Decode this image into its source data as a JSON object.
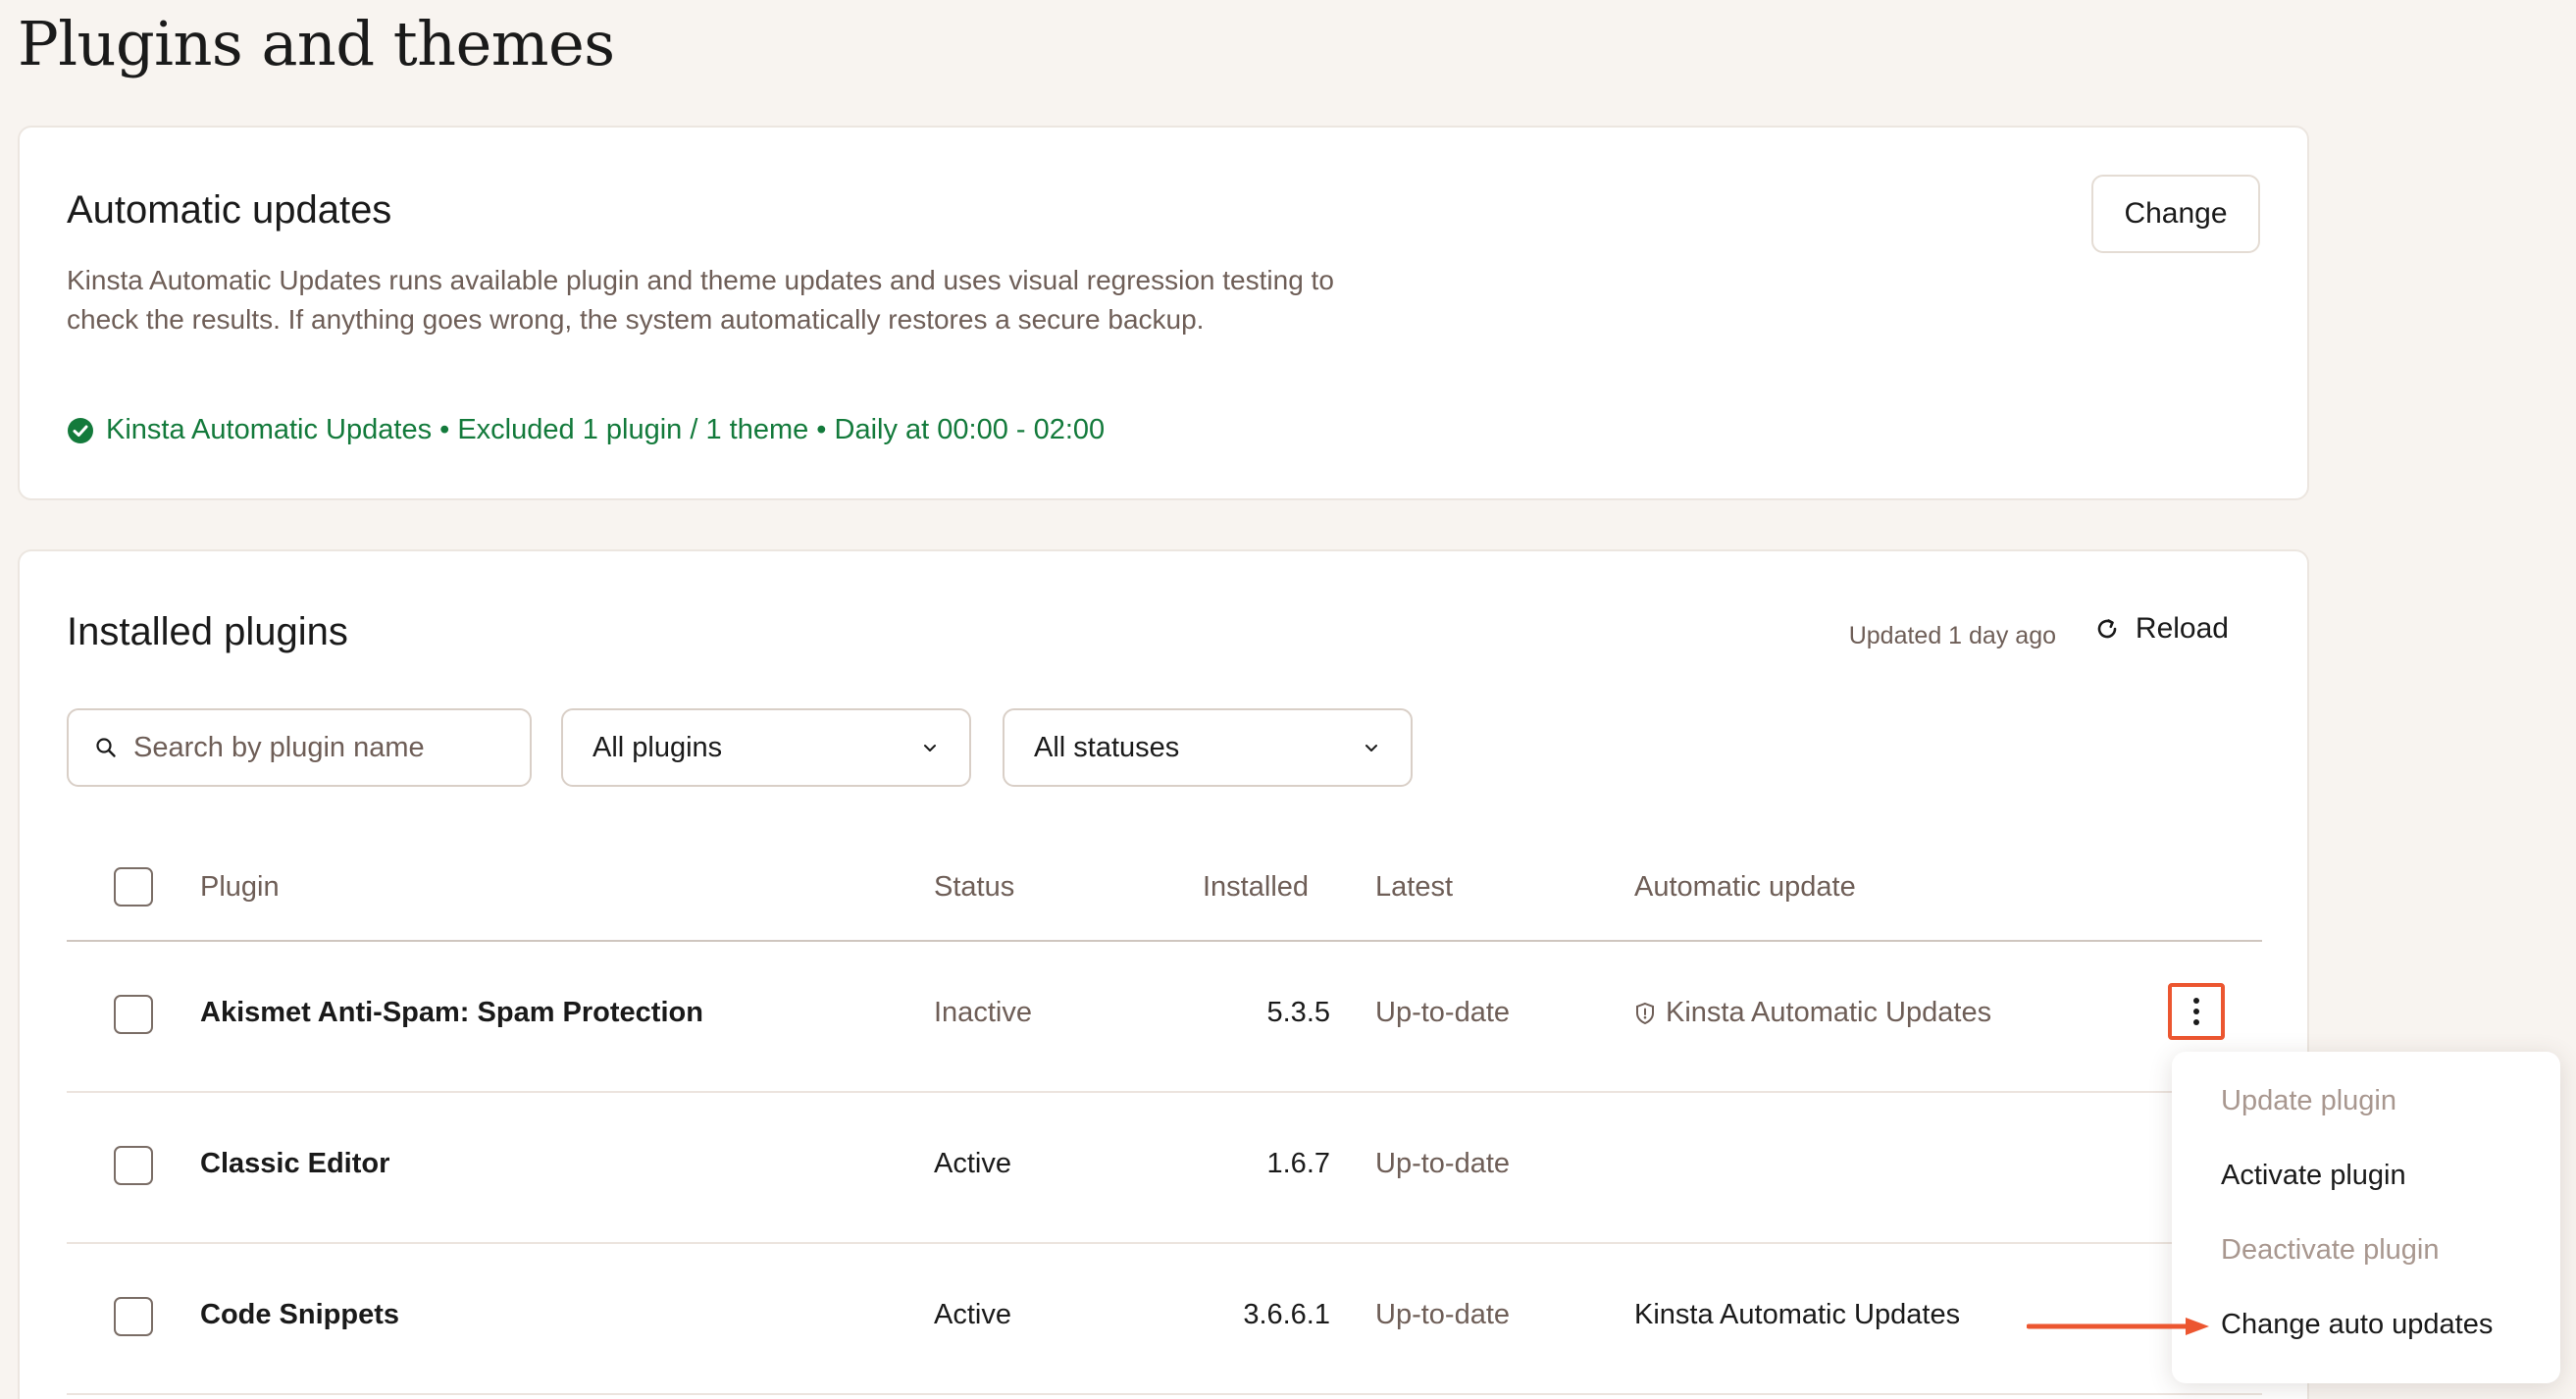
{
  "page": {
    "title": "Plugins and themes"
  },
  "automatic_updates": {
    "heading": "Automatic updates",
    "change_label": "Change",
    "description": "Kinsta Automatic Updates runs available plugin and theme updates and uses visual regression testing to check the results. If anything goes wrong, the system automatically restores a secure backup.",
    "status_text": "Kinsta Automatic Updates • Excluded 1 plugin / 1 theme • Daily at 00:00 - 02:00",
    "status_color": "#137a3b",
    "status_icon": "check-circle-icon"
  },
  "installed_plugins": {
    "heading": "Installed plugins",
    "updated_text": "Updated 1 day ago",
    "reload_label": "Reload",
    "search_placeholder": "Search by plugin name",
    "filter_plugins": "All plugins",
    "filter_statuses": "All statuses",
    "columns": {
      "plugin": "Plugin",
      "status": "Status",
      "installed": "Installed",
      "latest": "Latest",
      "auto_update": "Automatic update"
    },
    "rows": [
      {
        "name": "Akismet Anti-Spam: Spam Protection",
        "status": "Inactive",
        "installed": "5.3.5",
        "latest": "Up-to-date",
        "auto_update": "Kinsta Automatic Updates",
        "auto_icon": "shield-icon"
      },
      {
        "name": "Classic Editor",
        "status": "Active",
        "installed": "1.6.7",
        "latest": "Up-to-date",
        "auto_update": ""
      },
      {
        "name": "Code Snippets",
        "status": "Active",
        "installed": "3.6.6.1",
        "latest": "Up-to-date",
        "auto_update": "Kinsta Automatic Updates"
      }
    ]
  },
  "actions_menu": {
    "items": [
      {
        "label": "Update plugin",
        "enabled": false
      },
      {
        "label": "Activate plugin",
        "enabled": true
      },
      {
        "label": "Deactivate plugin",
        "enabled": false
      },
      {
        "label": "Change auto updates",
        "enabled": true
      }
    ]
  },
  "accent_color": "#ec5630"
}
